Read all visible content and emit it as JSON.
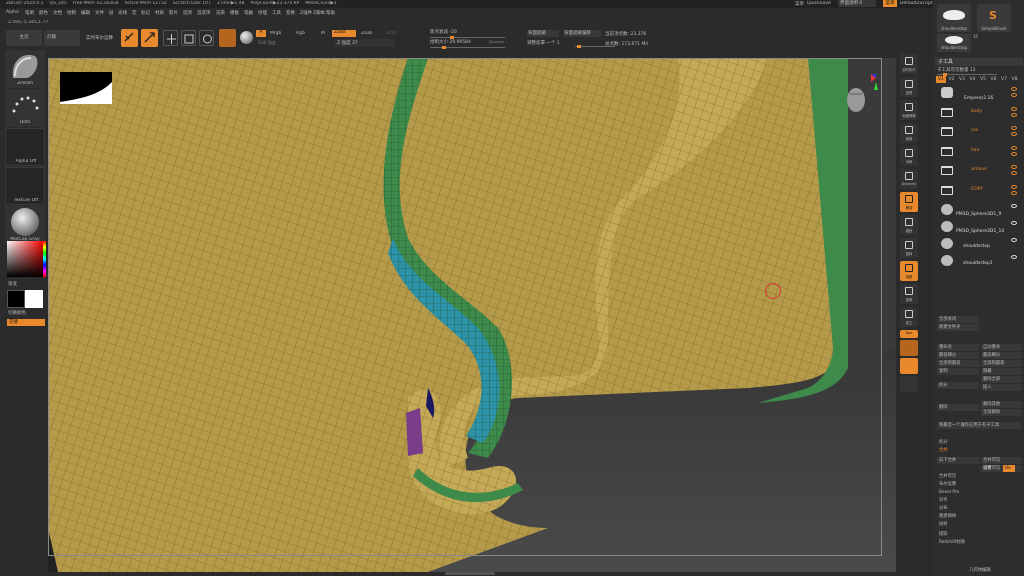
{
  "title_bar": {
    "items": [
      "ZBrush 2024.0.1",
      "QS_245",
      "Free Mem 43.283GB",
      "Active Mem 12732",
      "Scratch Disk 107",
      "ZTime▶1.48",
      "PolyCount▶23.374 KP",
      "MeshCount▶1"
    ],
    "right": [
      "菜单",
      "QuickSave",
      "界面透明 0",
      "菜单",
      "DefaultZScript"
    ]
  },
  "menu": [
    "Alpha",
    "笔刷",
    "颜色",
    "文档",
    "绘制",
    "编辑",
    "文件",
    "层",
    "光线",
    "宏",
    "标记",
    "材质",
    "影片",
    "选项",
    "首选项",
    "渲染",
    "模板",
    "笔触",
    "纹理",
    "工具",
    "变换",
    "Z插件",
    "Z脚本",
    "帮助"
  ],
  "coords": "2.595,-5.345,1.77",
  "toolbar": {
    "home": "主页",
    "lightbox": "灯箱",
    "live_boolean": "实时布尔运算",
    "edit": "编辑",
    "draw": "绘制",
    "move": "移动",
    "scale": "缩放",
    "rotate": "旋转",
    "a": "A",
    "mrgb": "Mrgb",
    "rgb": "Rgb",
    "m": "M",
    "zadd": "Zadd",
    "zsub": "Zsub",
    "zcut": "Zcut",
    "rgb_intensity": "RGB 强度",
    "z_intensity": "Z 强度 37",
    "focal_shift": "焦点衰减 -20",
    "draw_size": "绘制大小 29.90584",
    "dynamic": "Dynamic",
    "backface": "背面遮蔽",
    "backface2": "背面遮蔽偏移",
    "adjust": "调整遮罩 一个 1",
    "active_points": "当前顶点数: 23,376",
    "total_points": "总点数: 173,671 Mil"
  },
  "left_shelf": {
    "brush": "ZPolish",
    "stroke": "Dots",
    "alpha": "Alpha Off",
    "texture": "Texture Off",
    "material": "MatCap Gray",
    "gradient": "渐变",
    "switch_color": "切换颜色",
    "alternate": "交替"
  },
  "right_tray": {
    "buttons": [
      "实时布尔",
      "透视",
      "地面网格",
      "局部",
      "对称",
      "Dynamic",
      "移动",
      "缩放",
      "旋转",
      "线框",
      "透明",
      "孤立",
      "Dyn"
    ]
  },
  "right_panel": {
    "top_tools": [
      "shoulderstop",
      "SimpleBrush",
      "shoulderstop",
      "35"
    ],
    "subtool_title": "子工具",
    "subtool_count": "子工具可见数量 12",
    "tabs": [
      "V1",
      "V2",
      "V3",
      "V4",
      "V5",
      "V6",
      "V7",
      "V8"
    ],
    "layers": [
      {
        "name": "Emperor2.16",
        "folder": false
      },
      {
        "name": "body",
        "folder": true
      },
      {
        "name": "sss",
        "folder": true
      },
      {
        "name": "hair",
        "folder": true
      },
      {
        "name": "armour",
        "folder": true
      },
      {
        "name": "COPY",
        "folder": true
      },
      {
        "name": "PM3D_Sphere3D1_9",
        "folder": false
      },
      {
        "name": "PM3D_Sphere3D1_10",
        "folder": false
      },
      {
        "name": "shouldertop",
        "folder": false
      },
      {
        "name": "shouldertop1",
        "folder": false
      }
    ],
    "actions": [
      "全部关闭",
      "新建文件夹",
      "重命名",
      "自动重命",
      "最低细分",
      "最高细分",
      "全部到最低",
      "全部到最高",
      "复制",
      "隐藏",
      "删除全部",
      "拆分",
      "插入",
      "删除",
      "删除其他",
      "全部删除",
      "将最后一个操作应用于有子工具",
      "拆分",
      "合并",
      "向下合并",
      "合并可见",
      "调整",
      "Uv",
      "运算可见",
      "合并可见",
      "布尔运算",
      "Bevel Pro",
      "对齐",
      "分布",
      "重建网格",
      "投射",
      "提取",
      "Redshift材质",
      "几何体编辑"
    ]
  },
  "colors": {
    "accent": "#e7892c",
    "panel": "#2b2b2b",
    "mesh_gold": "#b59a4a",
    "mesh_green": "#3d8a4a",
    "mesh_cyan": "#2d93a8",
    "mesh_purple": "#7a3d8a"
  }
}
